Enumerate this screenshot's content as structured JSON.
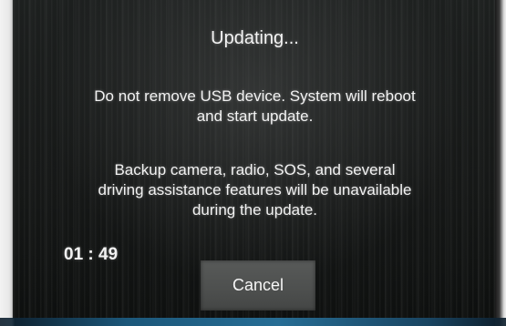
{
  "dialog": {
    "title": "Updating...",
    "message_1": {
      "line_1": "Do not remove USB device. System will reboot",
      "line_2": "and start update."
    },
    "message_2": {
      "line_1": "Backup camera, radio, SOS, and several",
      "line_2": "driving assistance features will be unavailable",
      "line_3": "during the update."
    },
    "timer": "01 : 49",
    "cancel_label": "Cancel"
  },
  "colors": {
    "background": "#171918",
    "text": "#f2f2f2",
    "button": "#535554",
    "bottom_accent": "#2a78a4"
  }
}
